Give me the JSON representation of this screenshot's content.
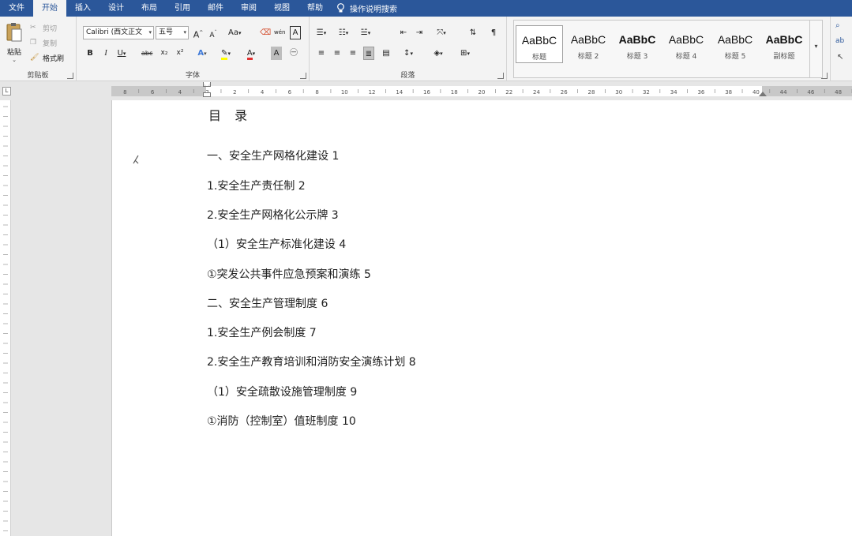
{
  "tabs": [
    {
      "label": "文件",
      "active": false
    },
    {
      "label": "开始",
      "active": true
    },
    {
      "label": "插入",
      "active": false
    },
    {
      "label": "设计",
      "active": false
    },
    {
      "label": "布局",
      "active": false
    },
    {
      "label": "引用",
      "active": false
    },
    {
      "label": "邮件",
      "active": false
    },
    {
      "label": "审阅",
      "active": false
    },
    {
      "label": "视图",
      "active": false
    },
    {
      "label": "帮助",
      "active": false
    }
  ],
  "tell_me": "操作说明搜索",
  "clipboard": {
    "paste": "粘贴",
    "cut": "剪切",
    "copy": "复制",
    "format_painter": "格式刷",
    "label": "剪贴板"
  },
  "font": {
    "family": "Calibri (西文正文",
    "size": "五号",
    "grow": "A",
    "shrink": "A",
    "case": "Aa",
    "phonetic": "wén",
    "border_char": "A",
    "bold": "B",
    "italic": "I",
    "underline": "U",
    "strike": "abc",
    "subscript": "x₂",
    "superscript": "x²",
    "label": "字体"
  },
  "paragraph": {
    "label": "段落"
  },
  "styles": {
    "label": "样式",
    "items": [
      {
        "sample": "AaBbC",
        "name": "标题",
        "bold": false
      },
      {
        "sample": "AaBbC",
        "name": "标题 2",
        "bold": false
      },
      {
        "sample": "AaBbC",
        "name": "标题 3",
        "bold": true
      },
      {
        "sample": "AaBbC",
        "name": "标题 4",
        "bold": false
      },
      {
        "sample": "AaBbC",
        "name": "标题 5",
        "bold": false
      },
      {
        "sample": "AaBbC",
        "name": "副标题",
        "bold": true
      }
    ]
  },
  "ruler": {
    "ticks": [
      "8",
      "6",
      "4",
      "2",
      "2",
      "4",
      "6",
      "8",
      "10",
      "12",
      "14",
      "16",
      "18",
      "20",
      "22",
      "24",
      "26",
      "28",
      "30",
      "32",
      "34",
      "36",
      "38",
      "40",
      "44",
      "46",
      "48"
    ]
  },
  "document": {
    "title": "目 录",
    "items": [
      "一、安全生产网格化建设 1",
      "1.安全生产责任制 2",
      "2.安全生产网格化公示牌 3",
      "（1）安全生产标准化建设 4",
      "①突发公共事件应急预案和演练 5",
      "二、安全生产管理制度 6",
      "1.安全生产例会制度 7",
      "2.安全生产教育培训和消防安全演练计划 8",
      "（1）安全疏散设施管理制度 9",
      "①消防（控制室）值班制度 10"
    ]
  },
  "colors": {
    "accent": "#2b579a",
    "ribbon_bg": "#f3f3f3"
  }
}
